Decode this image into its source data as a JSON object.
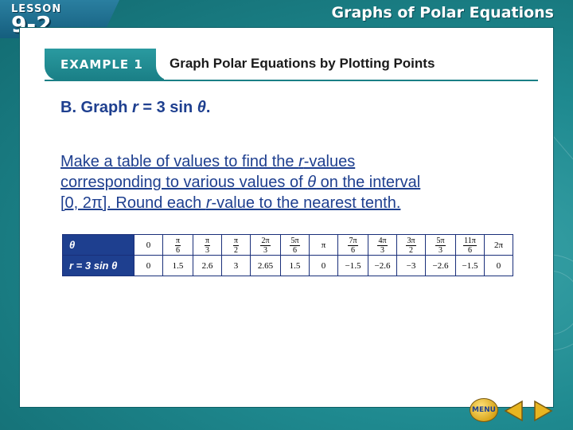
{
  "header": {
    "lesson_label": "LESSON",
    "lesson_number": "9-2",
    "title": "Graphs of Polar Equations"
  },
  "example": {
    "tab_label": "EXAMPLE 1",
    "heading": "Graph Polar Equations by Plotting Points"
  },
  "part": {
    "prefix": "B. Graph ",
    "var_r": "r",
    "equation_middle": " = 3 sin ",
    "var_theta": "θ",
    "suffix": "."
  },
  "instruction": {
    "line1_a": "Make a table of values to find the ",
    "line1_r": "r",
    "line1_b": "-values",
    "line2_a": "corresponding to various values of ",
    "line2_theta": "θ",
    "line2_b": " on the interval",
    "line3_a": "[0, 2π]. Round each ",
    "line3_r": "r",
    "line3_b": "-value to the nearest tenth."
  },
  "table": {
    "row1_header": "θ",
    "row2_header": "r = 3 sin θ",
    "theta_values": [
      {
        "whole": "0"
      },
      {
        "num": "π",
        "den": "6"
      },
      {
        "num": "π",
        "den": "3"
      },
      {
        "num": "π",
        "den": "2"
      },
      {
        "num": "2π",
        "den": "3"
      },
      {
        "num": "5π",
        "den": "6"
      },
      {
        "whole": "π"
      },
      {
        "num": "7π",
        "den": "6"
      },
      {
        "num": "4π",
        "den": "3"
      },
      {
        "num": "3π",
        "den": "2"
      },
      {
        "num": "5π",
        "den": "3"
      },
      {
        "num": "11π",
        "den": "6"
      },
      {
        "whole": "2π"
      }
    ],
    "r_values": [
      "0",
      "1.5",
      "2.6",
      "3",
      "2.65",
      "1.5",
      "0",
      "−1.5",
      "−2.6",
      "−3",
      "−2.6",
      "−1.5",
      "0"
    ]
  },
  "nav": {
    "menu_label": "MENU",
    "prev_icon": "triangle-left-icon",
    "next_icon": "triangle-right-icon",
    "button_color": "#d8a51a"
  },
  "colors": {
    "teal_frame": "#1a7f86",
    "heading_blue": "#1e3f8f",
    "table_header": "#1e3f8f"
  }
}
